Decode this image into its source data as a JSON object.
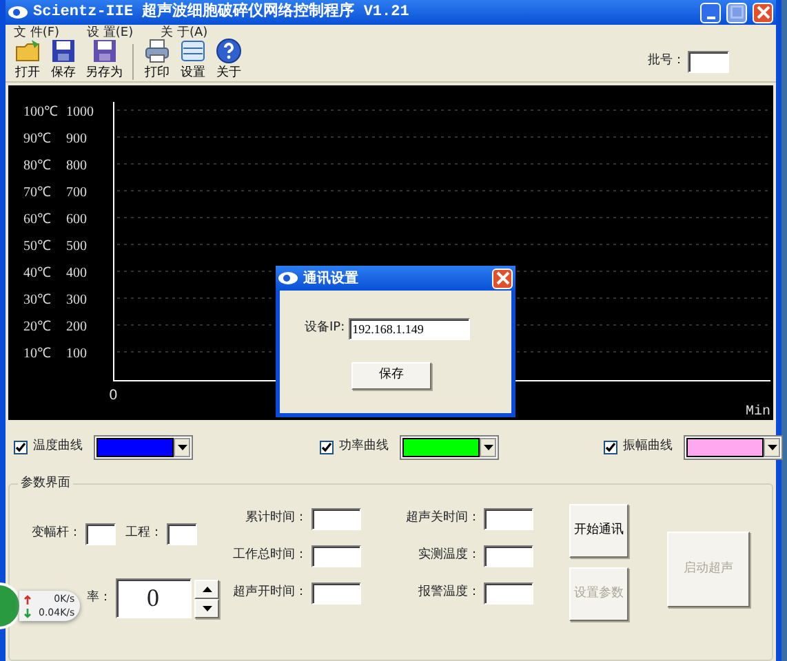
{
  "window": {
    "title": "Scientz-IIE 超声波细胞破碎仪网络控制程序 V1.21"
  },
  "menu": [
    "文 件(F)",
    "设 置(E)",
    "关 于(A)"
  ],
  "toolbar": [
    {
      "label": "打开",
      "kind": "open"
    },
    {
      "label": "保存",
      "kind": "save"
    },
    {
      "label": "另存为",
      "kind": "saveas"
    },
    {
      "label": "打印",
      "kind": "print"
    },
    {
      "label": "设置",
      "kind": "settings"
    },
    {
      "label": "关于",
      "kind": "about"
    }
  ],
  "batch": {
    "label": "批号："
  },
  "chart": {
    "temp_labels": [
      "100℃",
      "90℃",
      "80℃",
      "70℃",
      "60℃",
      "50℃",
      "40℃",
      "30℃",
      "20℃",
      "10℃"
    ],
    "power_labels": [
      "1000",
      "900",
      "800",
      "700",
      "600",
      "500",
      "400",
      "300",
      "200",
      "100"
    ],
    "x_origin": "0",
    "x_unit": "Min"
  },
  "curves": [
    {
      "label": "温度曲线",
      "checked": true,
      "color": "#0000ff"
    },
    {
      "label": "功率曲线",
      "checked": true,
      "color": "#00ff00"
    },
    {
      "label": "振幅曲线",
      "checked": true,
      "color": "#ffa8f0"
    }
  ],
  "params": {
    "title": "参数界面",
    "horn_label": "变幅杆：",
    "project_label": "工程：",
    "power_label": "率：",
    "power_value": "0",
    "mid_fields": [
      "累计时间：",
      "工作总时间：",
      "超声开时间："
    ],
    "right_fields": [
      "超声关时间：",
      "实测温度：",
      "报警温度："
    ],
    "buttons": [
      {
        "label": "开始通讯",
        "disabled": false
      },
      {
        "label": "设置参数",
        "disabled": true
      }
    ],
    "start": {
      "label": "启动超声",
      "disabled": true
    }
  },
  "dialog": {
    "title": "通讯设置",
    "ip_label": "设备IP:",
    "ip_value": "192.168.1.149",
    "button": "保存"
  },
  "speed_widget": {
    "upload": "0K/s",
    "download": "0.04K/s"
  }
}
